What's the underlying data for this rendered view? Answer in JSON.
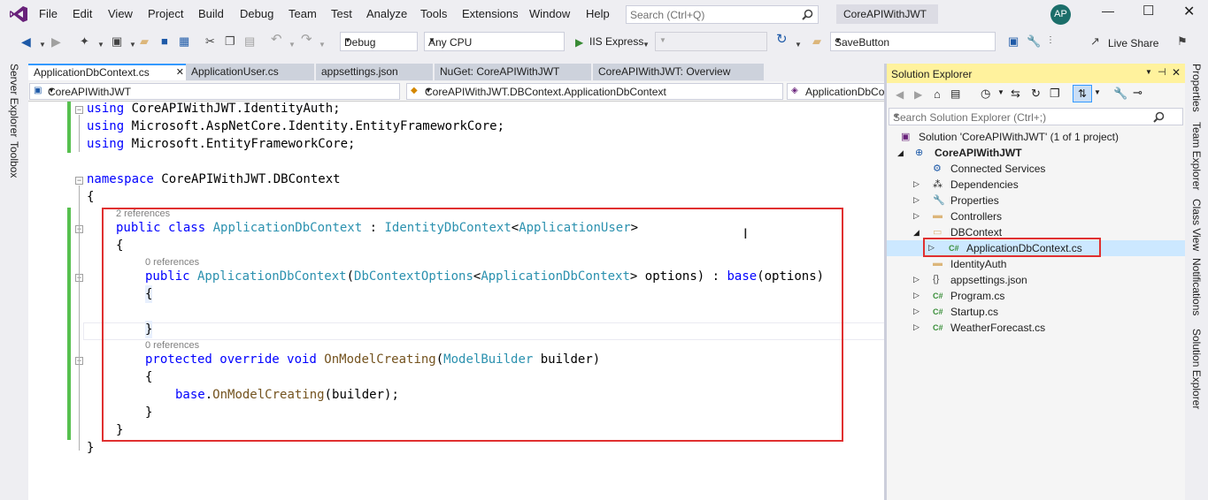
{
  "menu": {
    "items": [
      "File",
      "Edit",
      "View",
      "Project",
      "Build",
      "Debug",
      "Team",
      "Test",
      "Analyze",
      "Tools",
      "Extensions",
      "Window",
      "Help"
    ],
    "search_placeholder": "Search (Ctrl+Q)",
    "solution_title": "CoreAPIWithJWT",
    "avatar_initials": "AP"
  },
  "toolbar": {
    "config": "Debug",
    "platform": "Any CPU",
    "run_target": "IIS Express",
    "find_combo": "SaveButton",
    "live_share": "Live Share"
  },
  "left_strip": {
    "server_explorer": "Server Explorer",
    "toolbox": "Toolbox"
  },
  "right_strip": {
    "properties": "Properties",
    "team_explorer": "Team Explorer",
    "class_view": "Class View",
    "notifications": "Notifications",
    "solution_explorer": "Solution Explorer"
  },
  "tabs": [
    {
      "label": "ApplicationDbContext.cs",
      "active": true
    },
    {
      "label": "ApplicationUser.cs"
    },
    {
      "label": "appsettings.json"
    },
    {
      "label": "NuGet: CoreAPIWithJWT"
    },
    {
      "label": "CoreAPIWithJWT: Overview"
    }
  ],
  "nav": {
    "project": "CoreAPIWithJWT",
    "type": "CoreAPIWithJWT.DBContext.ApplicationDbContext",
    "member": "ApplicationDbContext"
  },
  "code": {
    "using1_kw": "using",
    "using1_ns": " CoreAPIWithJWT.IdentityAuth;",
    "using2_kw": "using",
    "using2_ns": " Microsoft.AspNetCore.Identity.EntityFrameworkCore;",
    "using3_kw": "using",
    "using3_ns": " Microsoft.EntityFrameworkCore;",
    "ns_kw": "namespace",
    "ns_name": " CoreAPIWithJWT.DBContext",
    "open_brace": "{",
    "close_brace": "}",
    "lens_class": "2 references",
    "class_public": "public",
    "class_kw": " class ",
    "class_name": "ApplicationDbContext",
    "class_colon": " : ",
    "base_type": "IdentityDbContext",
    "lt": "<",
    "generic_arg": "ApplicationUser",
    "gt": ">",
    "lens_ctor": "0 references",
    "ctor_public": "public",
    "ctor_name": " ApplicationDbContext",
    "ctor_paren": "(",
    "opt_type": "DbContextOptions",
    "opt_arg": "ApplicationDbContext",
    "opt_rest": "> options) : ",
    "base_kw": "base",
    "base_rest": "(options)",
    "lens_method": "0 references",
    "m_protected": "protected",
    "m_override": " override",
    "m_void": " void ",
    "m_name": "OnModelCreating",
    "m_paren": "(",
    "m_param_type": "ModelBuilder",
    "m_param": " builder)",
    "call_base": "base",
    "call_dot": ".",
    "call_name": "OnModelCreating",
    "call_rest": "(builder);"
  },
  "solution_explorer": {
    "title": "Solution Explorer",
    "search_placeholder": "Search Solution Explorer (Ctrl+;)",
    "solution": "Solution 'CoreAPIWithJWT' (1 of 1 project)",
    "project": "CoreAPIWithJWT",
    "items": [
      {
        "label": "Connected Services",
        "icon": "connected-services-icon"
      },
      {
        "label": "Dependencies",
        "icon": "dependencies-icon"
      },
      {
        "label": "Properties",
        "icon": "wrench-icon"
      },
      {
        "label": "Controllers",
        "icon": "folder-icon"
      },
      {
        "label": "DBContext",
        "icon": "folder-open-icon"
      },
      {
        "label": "ApplicationDbContext.cs",
        "icon": "csharp-file-icon",
        "selected": true
      },
      {
        "label": "IdentityAuth",
        "icon": "folder-icon"
      },
      {
        "label": "appsettings.json",
        "icon": "json-file-icon"
      },
      {
        "label": "Program.cs",
        "icon": "csharp-file-icon"
      },
      {
        "label": "Startup.cs",
        "icon": "csharp-file-icon"
      },
      {
        "label": "WeatherForecast.cs",
        "icon": "csharp-file-icon"
      }
    ]
  },
  "colors": {
    "accent": "#68217a",
    "keyword": "#0000ff",
    "type": "#2b91af",
    "highlight_box": "#e03030",
    "change_bar": "#57c04f",
    "se_title_bg": "#fff29d"
  }
}
